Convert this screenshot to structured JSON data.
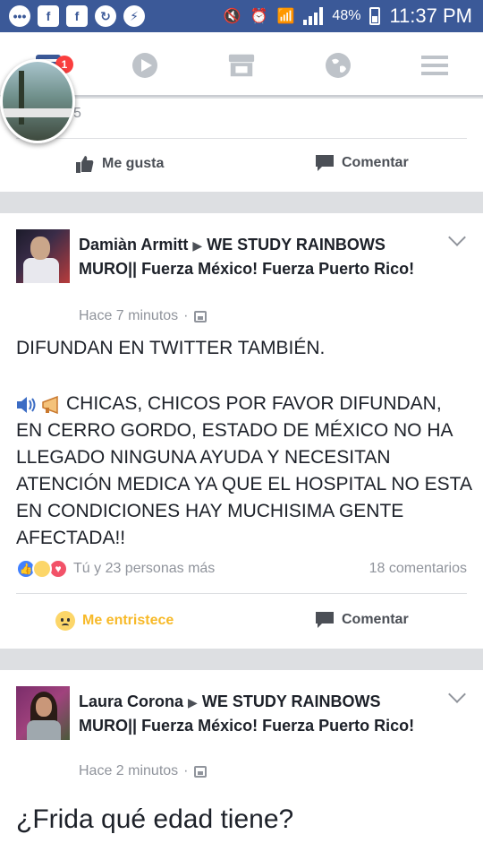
{
  "status_bar": {
    "battery": "48%",
    "time": "11:37 PM"
  },
  "nav": {
    "badge": "1",
    "items": [
      "feed-icon",
      "video-icon",
      "marketplace-icon",
      "globe-icon",
      "menu-icon"
    ]
  },
  "top_card": {
    "partial_count": "5",
    "like_label": "Me gusta",
    "comment_label": "Comentar"
  },
  "post1": {
    "author_line1": "Damiàn Armitt",
    "author_rest": "WE STUDY RAINBOWS MURO|| Fuerza México! Fuerza Puerto Rico!",
    "time": "Hace 7 minutos",
    "text_line1": "DIFUNDAN EN TWITTER TAMBIÉN.",
    "text_body": "CHICAS, CHICOS POR FAVOR DIFUNDAN, EN CERRO GORDO, ESTADO DE MÉXICO NO HA LLEGADO NINGUNA AYUDA Y NECESITAN ATENCIÓN MEDICA YA QUE EL HOSPITAL NO ESTA EN CONDICIONES HAY MUCHISIMA GENTE AFECTADA!!",
    "reactions_text": "Tú y 23 personas más",
    "comments_count": "18 comentarios",
    "reaction_label": "Me entristece",
    "comment_label": "Comentar"
  },
  "post2": {
    "author_line1": "Laura Corona",
    "author_rest": "WE STUDY RAINBOWS MURO|| Fuerza México! Fuerza Puerto Rico!",
    "time": "Hace 2 minutos",
    "text": "¿Frida qué edad tiene?"
  },
  "colors": {
    "brand": "#3b5998",
    "reaction_sad": "#f7b928",
    "link_text": "#4b4f56"
  }
}
